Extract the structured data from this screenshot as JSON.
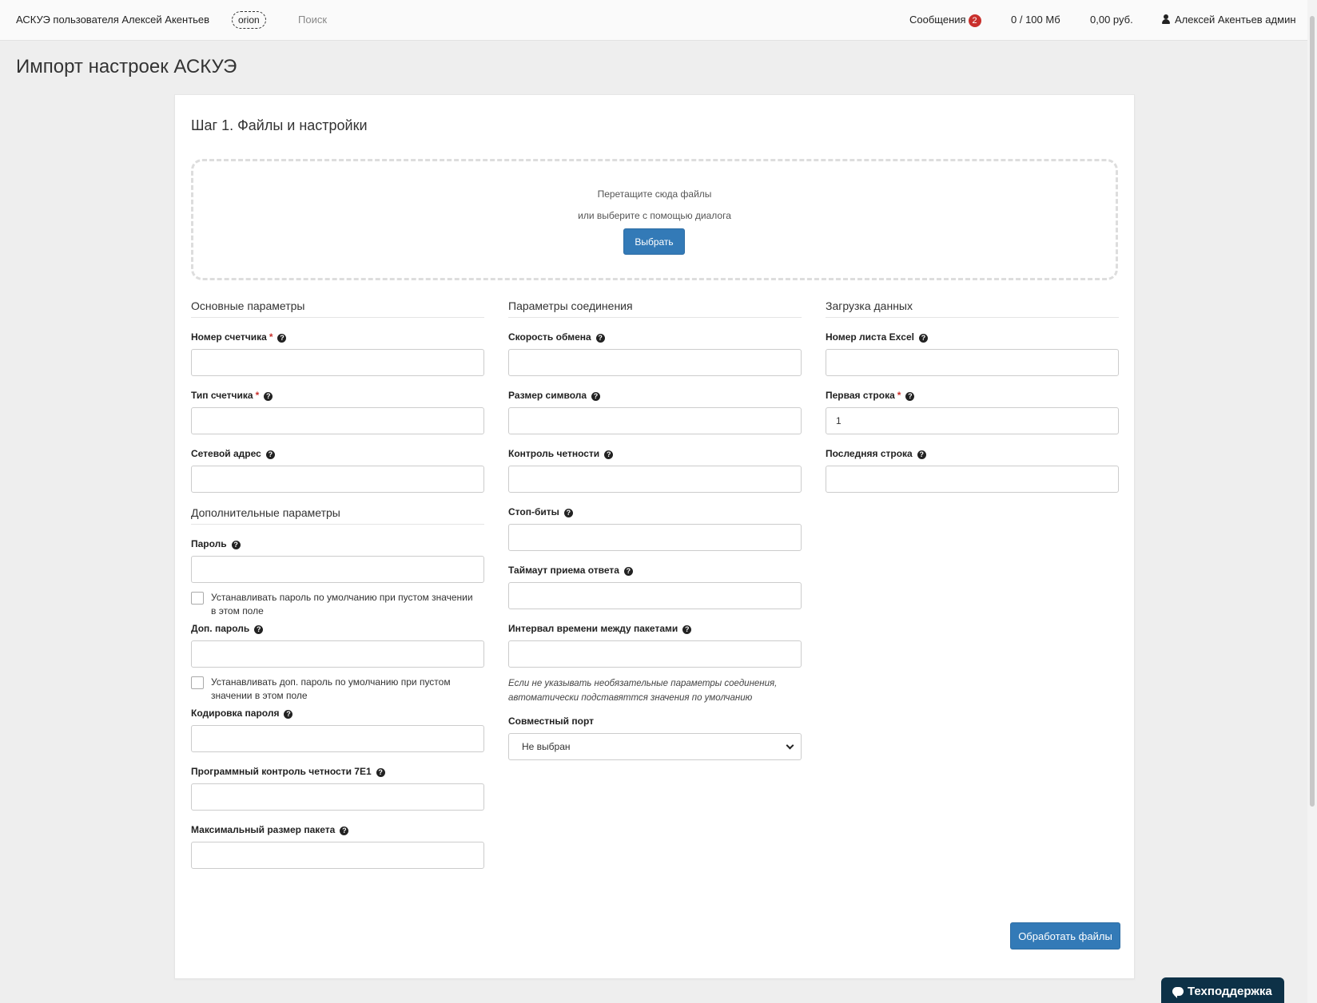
{
  "navbar": {
    "brand": "АСКУЭ пользователя Алексей Акентьев",
    "account_tag": "orion",
    "search": "Поиск",
    "messages_label": "Сообщения",
    "messages_count": "2",
    "storage": "0 / 100 Мб",
    "balance": "0,00 руб.",
    "user": "Алексей Акентьев админ"
  },
  "page": {
    "title": "Импорт настроек АСКУЭ",
    "step_title": "Шаг 1. Файлы и настройки"
  },
  "dropzone": {
    "line1": "Перетащите сюда файлы",
    "line2": "или выберите с помощью диалога",
    "button": "Выбрать"
  },
  "basic": {
    "title": "Основные параметры",
    "meter_number": "Номер счетчика",
    "meter_type": "Тип счетчика",
    "network_address": "Сетевой адрес"
  },
  "extra": {
    "title": "Дополнительные параметры",
    "password": "Пароль",
    "password_default": "Устанавливать пароль по умолчанию при пустом значении в этом поле",
    "extra_password": "Доп. пароль",
    "extra_password_default": "Устанавливать доп. пароль по умолчанию при пустом значении в этом поле",
    "password_encoding": "Кодировка пароля",
    "parity_7e1": "Программный контроль четности 7E1",
    "max_packet": "Максимальный размер пакета"
  },
  "connection": {
    "title": "Параметры соединения",
    "baud_rate": "Скорость обмена",
    "char_size": "Размер символа",
    "parity": "Контроль четности",
    "stop_bits": "Стоп-биты",
    "timeout": "Таймаут приема ответа",
    "interval": "Интервал времени между пакетами",
    "hint": "Если не указывать необязательные параметры соединения, автоматически подставяттся значения по умолчанию",
    "shared_port": "Совместный порт",
    "shared_port_value": "Не выбран"
  },
  "upload": {
    "title": "Загрузка данных",
    "sheet_number": "Номер листа Excel",
    "first_row": "Первая строка",
    "first_row_value": "1",
    "last_row": "Последняя строка"
  },
  "actions": {
    "process": "Обработать файлы"
  },
  "support": {
    "label": "Техподдержка"
  },
  "colors": {
    "primary": "#337ab7",
    "required": "#c9302c",
    "support_bg": "#0d3147"
  }
}
